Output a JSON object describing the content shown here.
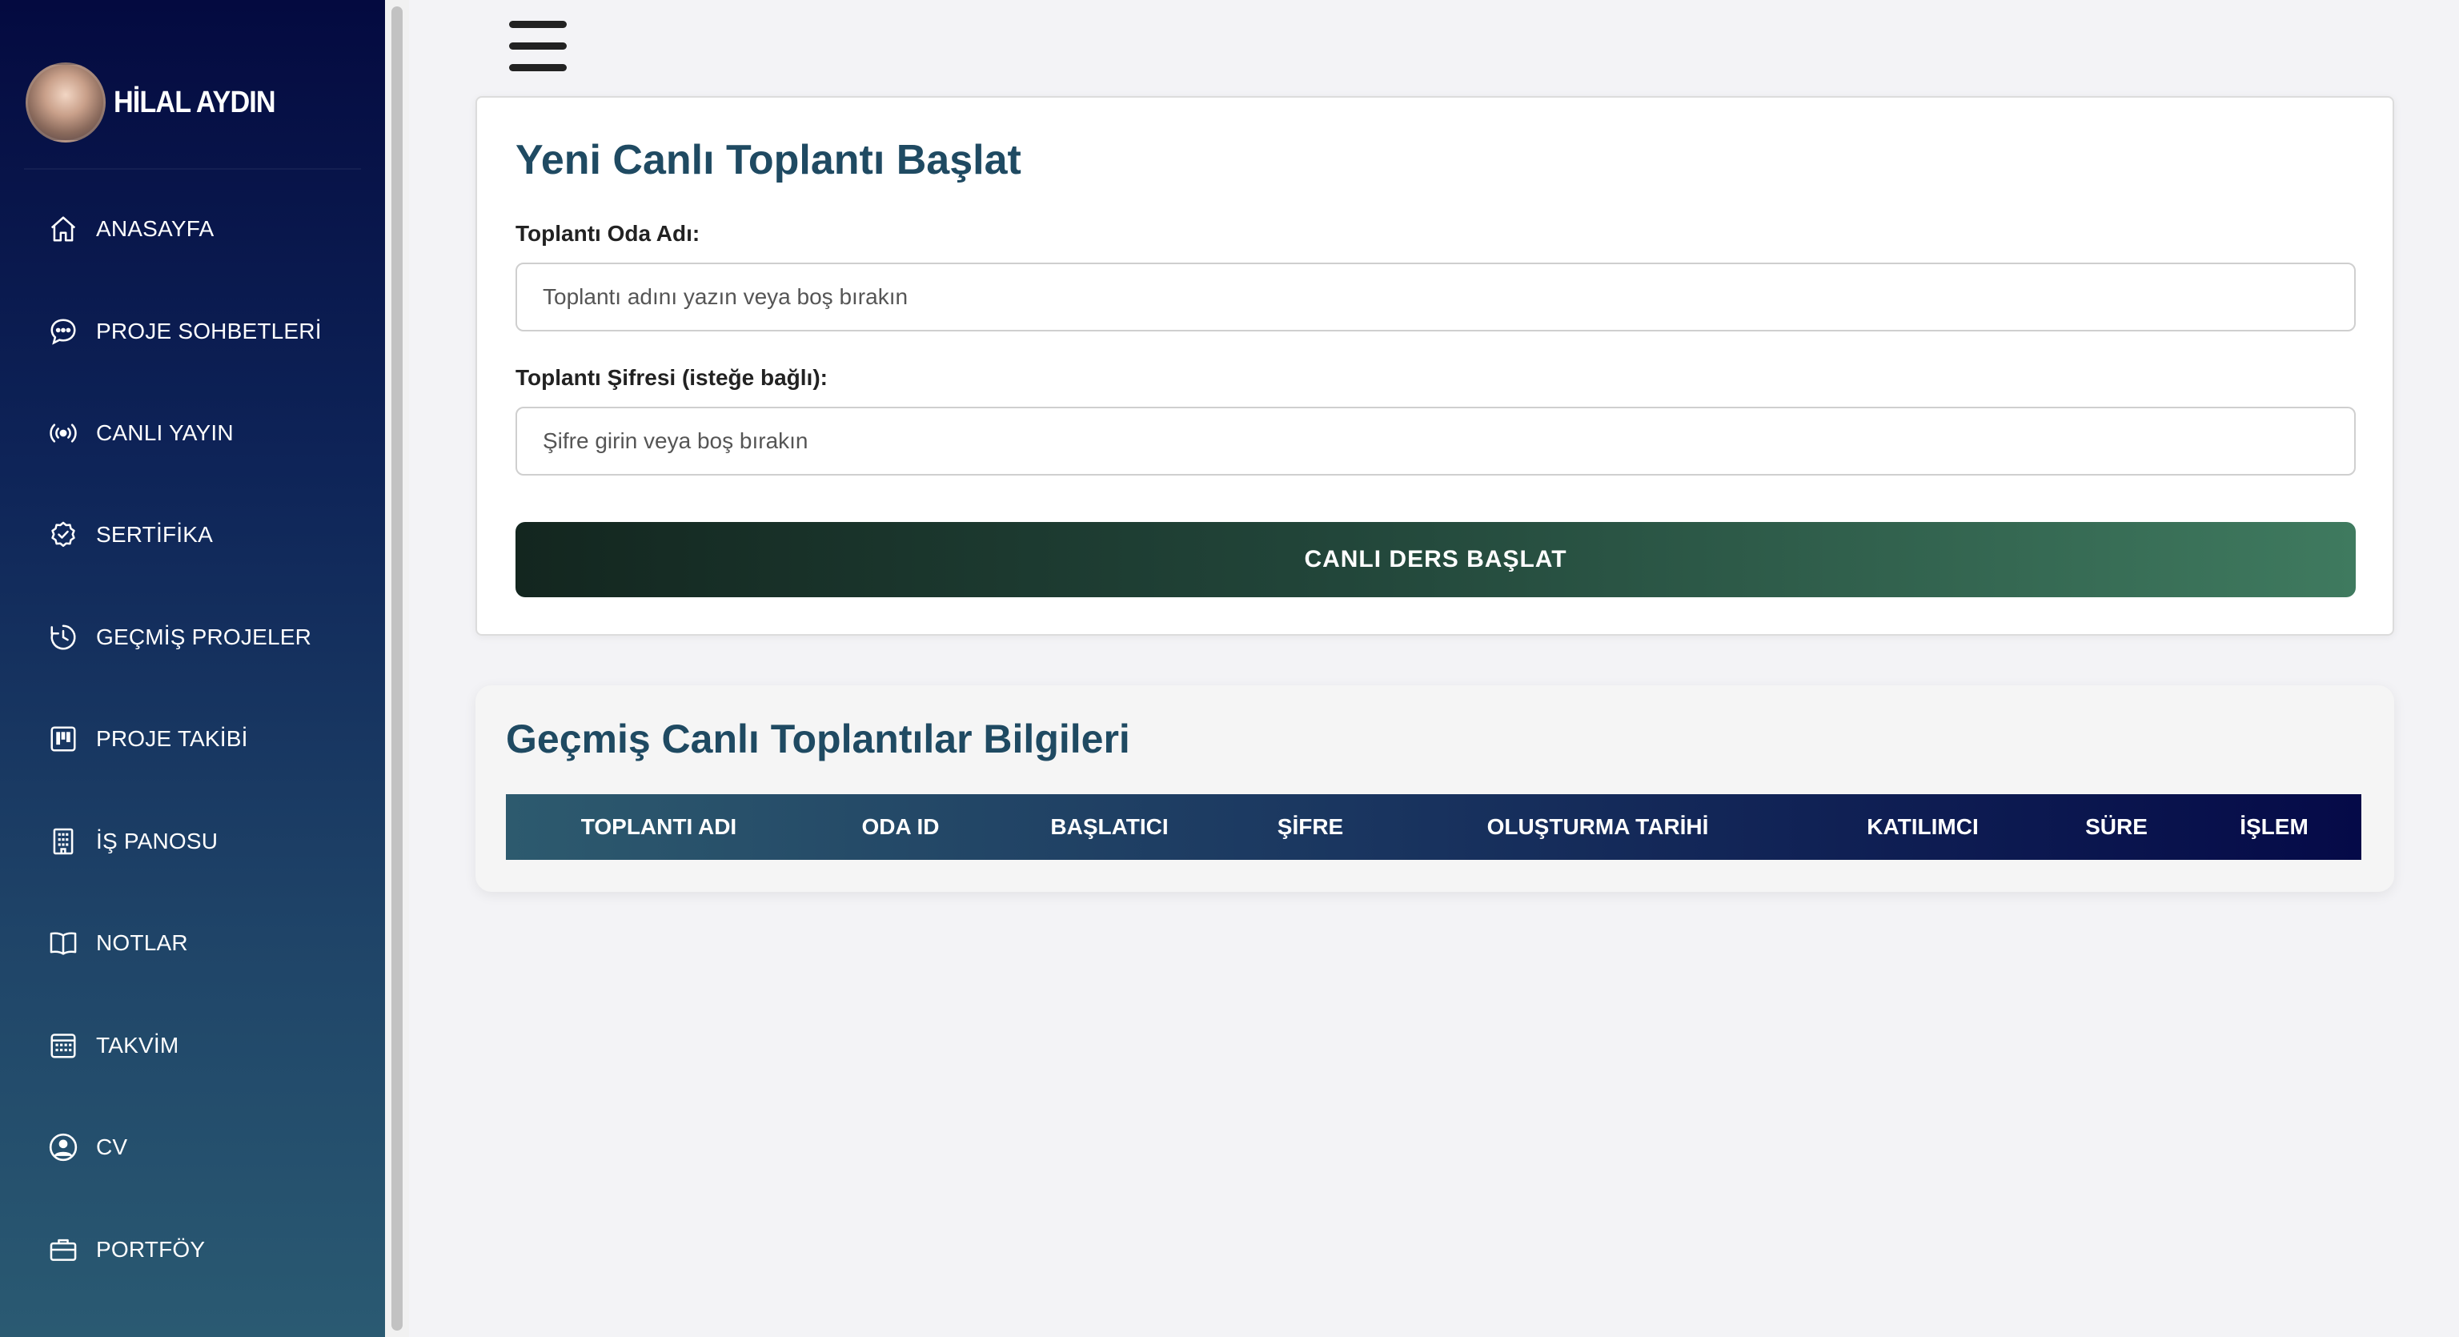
{
  "sidebar": {
    "user_name": "HİLAL AYDIN",
    "items": [
      {
        "label": "ANASAYFA",
        "icon": "home-icon"
      },
      {
        "label": "PROJE SOHBETLERİ",
        "icon": "chat-icon"
      },
      {
        "label": "CANLI YAYIN",
        "icon": "broadcast-icon"
      },
      {
        "label": "SERTİFİKA",
        "icon": "certificate-icon"
      },
      {
        "label": "GEÇMİŞ PROJELER",
        "icon": "clock-icon"
      },
      {
        "label": "PROJE TAKİBİ",
        "icon": "kanban-icon"
      },
      {
        "label": "İŞ PANOSU",
        "icon": "building-icon"
      },
      {
        "label": "NOTLAR",
        "icon": "book-icon"
      },
      {
        "label": "TAKVİM",
        "icon": "calendar-icon"
      },
      {
        "label": "CV",
        "icon": "person-circle-icon"
      },
      {
        "label": "PORTFÖY",
        "icon": "briefcase-icon"
      }
    ]
  },
  "start_meeting": {
    "title": "Yeni Canlı Toplantı Başlat",
    "room_label": "Toplantı Oda Adı:",
    "room_placeholder": "Toplantı adını yazın veya boş bırakın",
    "password_label": "Toplantı Şifresi (isteğe bağlı):",
    "password_placeholder": "Şifre girin veya boş bırakın",
    "button_label": "CANLI DERS BAŞLAT"
  },
  "past_meetings": {
    "title": "Geçmiş Canlı Toplantılar Bilgileri",
    "columns": [
      "TOPLANTI ADI",
      "ODA ID",
      "BAŞLATICI",
      "ŞİFRE",
      "OLUŞTURMA TARİHİ",
      "KATILIMCI",
      "SÜRE",
      "İŞLEM"
    ],
    "rows": []
  },
  "colors": {
    "title": "#1f4a62",
    "sidebar_top": "#040a40",
    "sidebar_bottom": "#2a5a72",
    "button_start": "#13261f",
    "button_end": "#3f7a5f"
  }
}
